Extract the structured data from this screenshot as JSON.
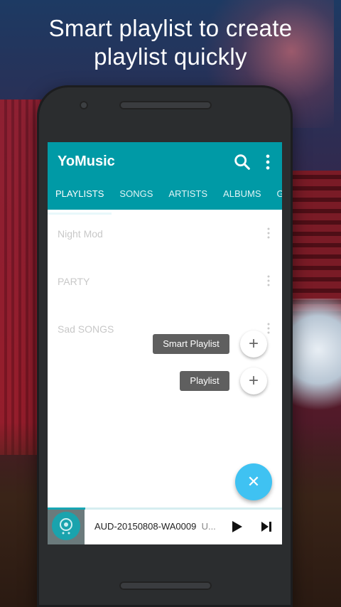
{
  "headline": {
    "line1": "Smart playlist to create",
    "line2": "playlist quickly"
  },
  "app": {
    "title": "YoMusic",
    "tabs": [
      "PLAYLISTS",
      "SONGS",
      "ARTISTS",
      "ALBUMS",
      "GEN"
    ],
    "active_tab": "PLAYLISTS",
    "accent_color": "#009aa6",
    "fab_color": "#3fc2f2"
  },
  "playlists": [
    {
      "name": "Night Mod"
    },
    {
      "name": "PARTY"
    },
    {
      "name": "Sad SONGS"
    }
  ],
  "fab_menu": {
    "smart_playlist_label": "Smart Playlist",
    "playlist_label": "Playlist",
    "main_icon": "close-icon"
  },
  "player": {
    "track": "AUD-20150808-WA0009",
    "track_suffix": "U...",
    "progress": 0.16
  }
}
